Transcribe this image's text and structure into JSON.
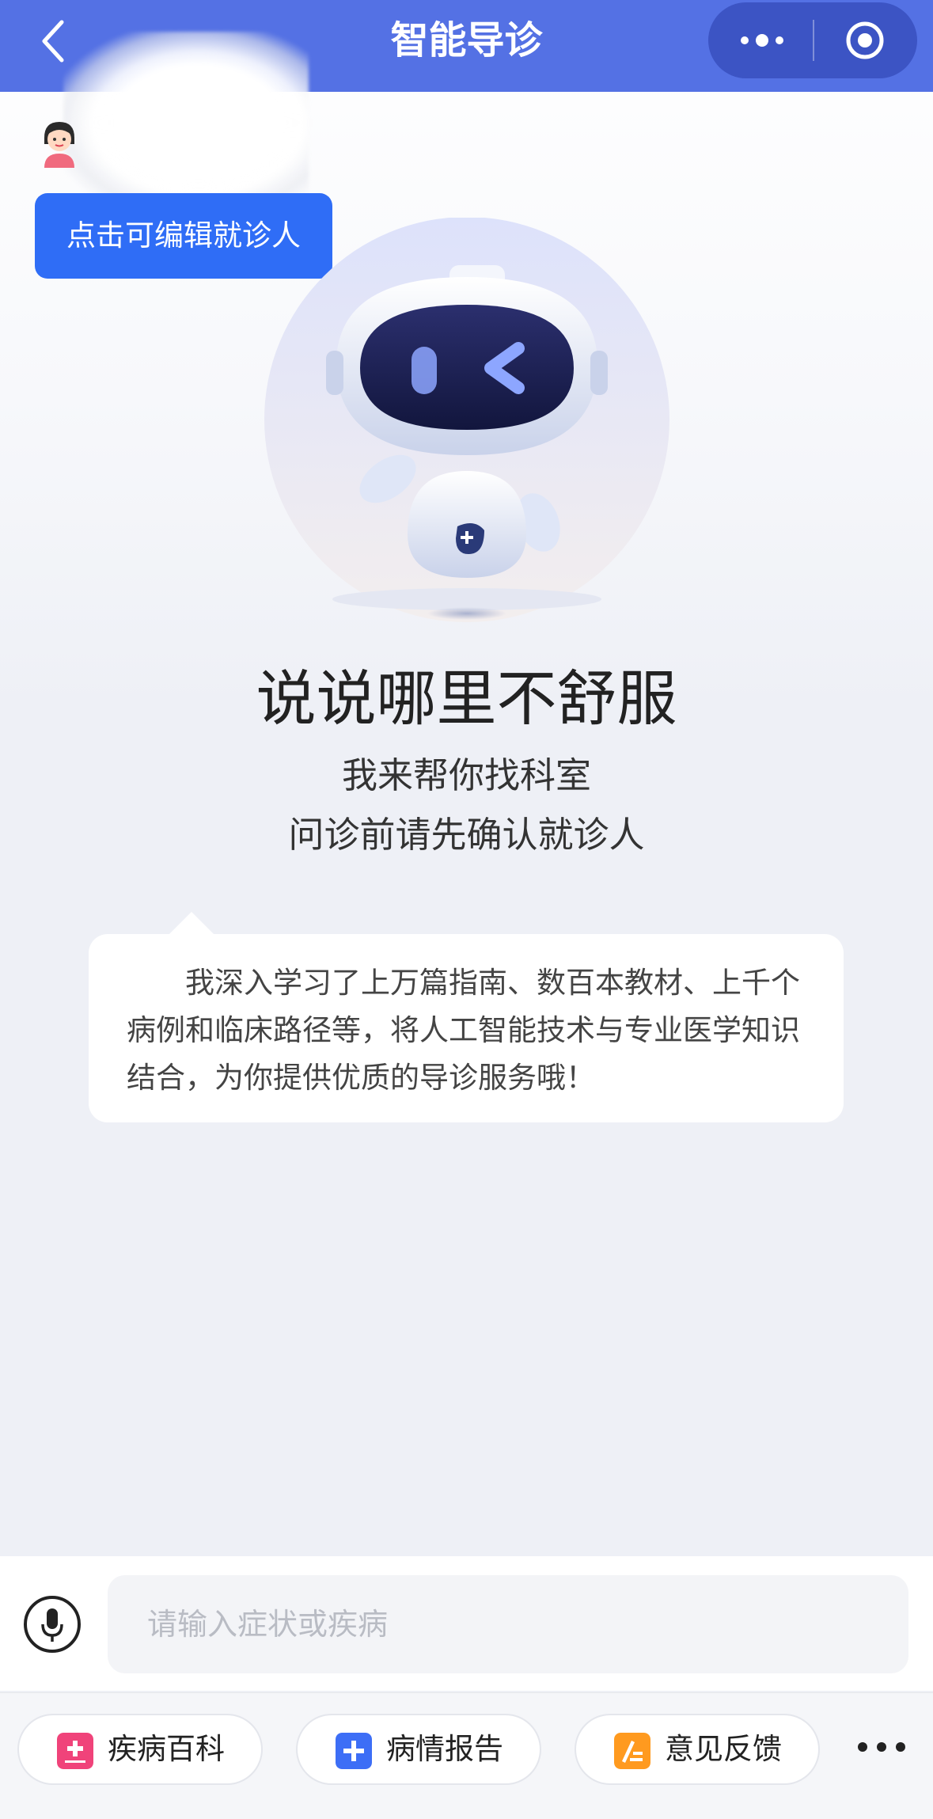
{
  "nav": {
    "title": "智能导诊"
  },
  "patient": {
    "edit_label": "点击可编辑就诊人"
  },
  "hero": {
    "headline": "说说哪里不舒服",
    "sub1": "我来帮你找科室",
    "sub2": "问诊前请先确认就诊人"
  },
  "bubble": {
    "text": "我深入学习了上万篇指南、数百本教材、上千个病例和临床路径等，将人工智能技术与专业医学知识结合，为你提供优质的导诊服务哦！"
  },
  "input": {
    "placeholder": "请输入症状或疾病"
  },
  "toolbar": {
    "items": [
      {
        "label": "疾病百科",
        "icon": "encyclopedia-icon",
        "color": "#f0437a"
      },
      {
        "label": "病情报告",
        "icon": "report-plus-icon",
        "color": "#3d6ef6"
      },
      {
        "label": "意见反馈",
        "icon": "feedback-icon",
        "color": "#ff9a1f"
      }
    ]
  },
  "colors": {
    "nav_bg": "#5471e4",
    "accent": "#2f6df6"
  }
}
